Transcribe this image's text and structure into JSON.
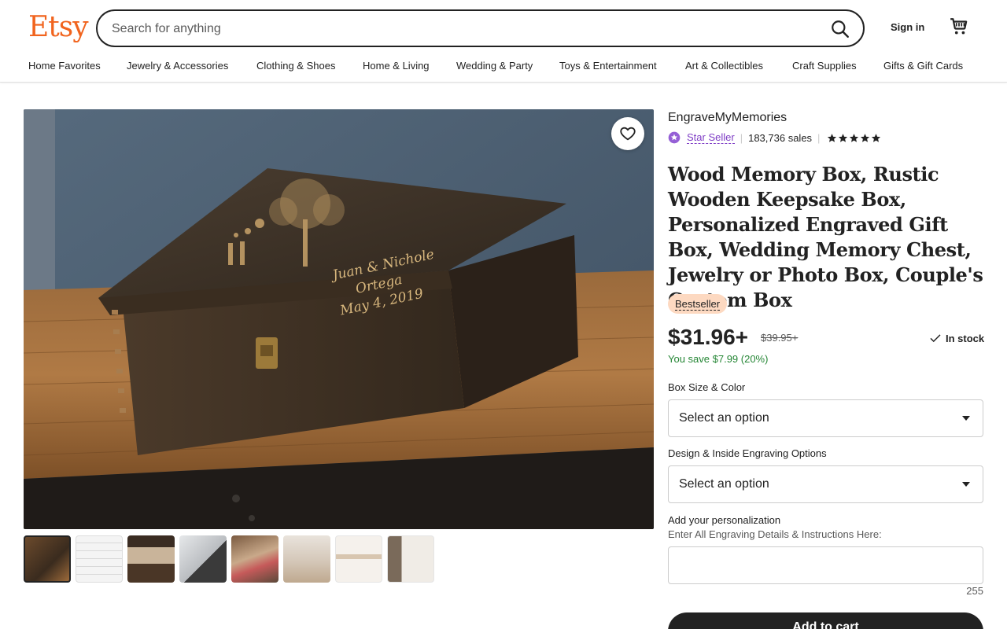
{
  "header": {
    "logo": "Etsy",
    "search_placeholder": "Search for anything",
    "sign_in": "Sign in",
    "categories": [
      "Home Favorites",
      "Jewelry & Accessories",
      "Clothing & Shoes",
      "Home & Living",
      "Wedding & Party",
      "Toys & Entertainment",
      "Art & Collectibles",
      "Craft Supplies",
      "Gifts & Gift Cards"
    ]
  },
  "gallery": {
    "engraving_lines": [
      "Juan & Nichole",
      "Ortega",
      "May 4, 2019"
    ],
    "thumbnail_count": 8,
    "active_thumbnail": 1
  },
  "listing": {
    "shop_name": "EngraveMyMemories",
    "star_seller": "Star Seller",
    "sales": "183,736 sales",
    "rating": 5,
    "title": "Wood Memory Box, Rustic Wooden Keepsake Box, Personalized Engraved Gift Box, Wedding Memory Chest, Jewelry or Photo Box, Couple's Custom Box",
    "badge": "Bestseller",
    "price": "$31.96+",
    "original_price": "$39.95+",
    "stock": "In stock",
    "savings": "You save $7.99 (20%)",
    "option1_label": "Box Size & Color",
    "option1_value": "Select an option",
    "option2_label": "Design & Inside Engraving Options",
    "option2_value": "Select an option",
    "personalization_label": "Add your personalization",
    "personalization_hint": "Enter All Engraving Details & Instructions Here:",
    "char_count": "255",
    "add_to_cart": "Add to cart"
  },
  "colors": {
    "brand": "#f1641e",
    "star_seller": "#7f3ec6",
    "savings": "#258635",
    "badge_bg": "#fdd9c1"
  }
}
